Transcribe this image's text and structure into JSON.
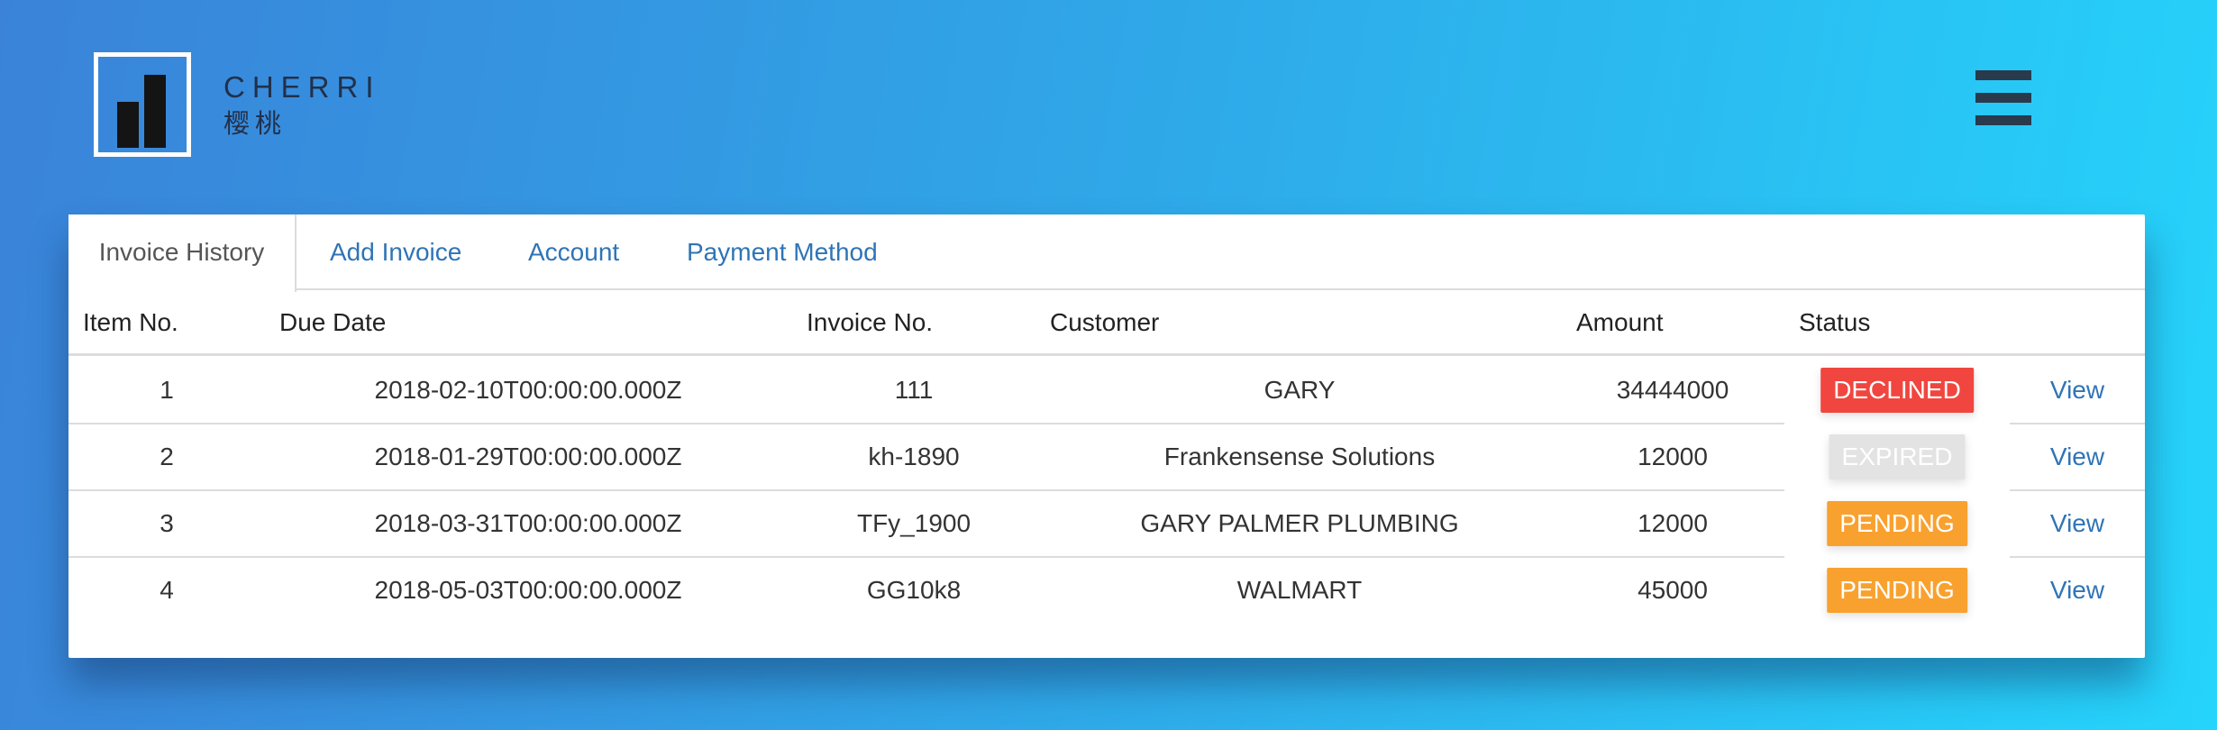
{
  "brand": {
    "name": "CHERRI",
    "subtitle": "樱桃"
  },
  "tabs": [
    {
      "label": "Invoice History",
      "active": true
    },
    {
      "label": "Add Invoice",
      "active": false
    },
    {
      "label": "Account",
      "active": false
    },
    {
      "label": "Payment Method",
      "active": false
    }
  ],
  "table": {
    "headers": [
      "Item No.",
      "Due Date",
      "Invoice No.",
      "Customer",
      "Amount",
      "Status"
    ],
    "rows": [
      {
        "item": "1",
        "due_date": "2018-02-10T00:00:00.000Z",
        "invoice_no": "111",
        "customer": "GARY",
        "amount": "34444000",
        "status": "DECLINED",
        "action": "View"
      },
      {
        "item": "2",
        "due_date": "2018-01-29T00:00:00.000Z",
        "invoice_no": "kh-1890",
        "customer": "Frankensense Solutions",
        "amount": "12000",
        "status": "EXPIRED",
        "action": "View"
      },
      {
        "item": "3",
        "due_date": "2018-03-31T00:00:00.000Z",
        "invoice_no": "TFy_1900",
        "customer": "GARY PALMER PLUMBING",
        "amount": "12000",
        "status": "PENDING",
        "action": "View"
      },
      {
        "item": "4",
        "due_date": "2018-05-03T00:00:00.000Z",
        "invoice_no": "GG10k8",
        "customer": "WALMART",
        "amount": "45000",
        "status": "PENDING",
        "action": "View"
      }
    ]
  },
  "status_colors": {
    "DECLINED": "#f0463f",
    "EXPIRED": "#e3e3e3",
    "PENDING": "#f9a12e"
  },
  "icons": {
    "logo": "bar-chart-logo-icon",
    "menu": "hamburger-menu-icon"
  }
}
